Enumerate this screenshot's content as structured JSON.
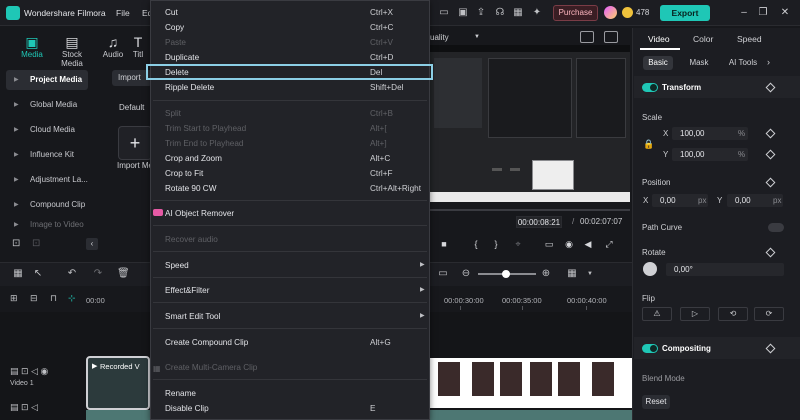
{
  "app": {
    "title": "Wondershare Filmora",
    "menu": [
      "File",
      "Ed"
    ],
    "purchase_label": "Purchase",
    "credits": "478",
    "export_label": "Export",
    "accent": "#1fc7b6"
  },
  "media_tabs": [
    {
      "label": "Media",
      "icon": "media-icon"
    },
    {
      "label": "Stock Media",
      "icon": "stock-media-icon"
    },
    {
      "label": "Audio",
      "icon": "audio-icon"
    },
    {
      "label": "Titl",
      "icon": "titles-icon"
    }
  ],
  "sidebar": {
    "items": [
      {
        "label": "Project Media"
      },
      {
        "label": "Global Media"
      },
      {
        "label": "Cloud Media"
      },
      {
        "label": "Influence Kit"
      },
      {
        "label": "Adjustment La..."
      },
      {
        "label": "Compound Clip"
      },
      {
        "label": "Image to Video"
      }
    ]
  },
  "media_panel": {
    "import_label": "Import",
    "sort_label": "Default",
    "import_tile_label": "Import Me"
  },
  "preview": {
    "quality_label": "uality",
    "current_time": "00:00:08:21",
    "separator": "/",
    "total_time": "00:02:07:07"
  },
  "timeline": {
    "ruler": [
      "00:00",
      "00:00:30:00",
      "00:00:35:00",
      "00:00:40:00"
    ],
    "clip_title": "Recorded V",
    "track_label": "Video 1"
  },
  "properties": {
    "tabs": [
      "Video",
      "Color",
      "Speed"
    ],
    "subtabs": [
      "Basic",
      "Mask",
      "AI Tools"
    ],
    "transform_label": "Transform",
    "scale_label": "Scale",
    "scale_x_axis": "X",
    "scale_y_axis": "Y",
    "scale_x": "100,00",
    "scale_y": "100,00",
    "scale_unit": "%",
    "position_label": "Position",
    "pos_x_axis": "X",
    "pos_y_axis": "Y",
    "pos_x": "0,00",
    "pos_y": "0,00",
    "pos_unit": "px",
    "path_curve_label": "Path Curve",
    "rotate_label": "Rotate",
    "rotate_value": "0,00°",
    "flip_label": "Flip",
    "compositing_label": "Compositing",
    "blend_mode_label": "Blend Mode",
    "reset_label": "Reset"
  },
  "context_menu": {
    "items": [
      {
        "label": "Cut",
        "shortcut": "Ctrl+X",
        "enabled": true
      },
      {
        "label": "Copy",
        "shortcut": "Ctrl+C",
        "enabled": true
      },
      {
        "label": "Paste",
        "shortcut": "Ctrl+V",
        "enabled": false
      },
      {
        "label": "Duplicate",
        "shortcut": "Ctrl+D",
        "enabled": true
      },
      {
        "label": "Delete",
        "shortcut": "Del",
        "enabled": true,
        "highlighted": true
      },
      {
        "label": "Ripple Delete",
        "shortcut": "Shift+Del",
        "enabled": true
      },
      {
        "label": "Split",
        "shortcut": "Ctrl+B",
        "enabled": false
      },
      {
        "label": "Trim Start to Playhead",
        "shortcut": "Alt+[",
        "enabled": false
      },
      {
        "label": "Trim End to Playhead",
        "shortcut": "Alt+]",
        "enabled": false
      },
      {
        "label": "Crop and Zoom",
        "shortcut": "Alt+C",
        "enabled": true
      },
      {
        "label": "Crop to Fit",
        "shortcut": "Ctrl+F",
        "enabled": true
      },
      {
        "label": "Rotate 90 CW",
        "shortcut": "Ctrl+Alt+Right",
        "enabled": true
      },
      {
        "label": "AI Object Remover",
        "shortcut": "",
        "enabled": true
      },
      {
        "label": "Recover audio",
        "shortcut": "",
        "enabled": false
      },
      {
        "label": "Speed",
        "shortcut": "",
        "enabled": true,
        "submenu": true
      },
      {
        "label": "Effect&Filter",
        "shortcut": "",
        "enabled": true,
        "submenu": true
      },
      {
        "label": "Smart Edit Tool",
        "shortcut": "",
        "enabled": true,
        "submenu": true
      },
      {
        "label": "Create Compound Clip",
        "shortcut": "Alt+G",
        "enabled": true
      },
      {
        "label": "Create Multi-Camera Clip",
        "shortcut": "",
        "enabled": false
      },
      {
        "label": "Rename",
        "shortcut": "",
        "enabled": true
      },
      {
        "label": "Disable Clip",
        "shortcut": "E",
        "enabled": true
      }
    ],
    "highlight_color": "#8ccfe6"
  }
}
